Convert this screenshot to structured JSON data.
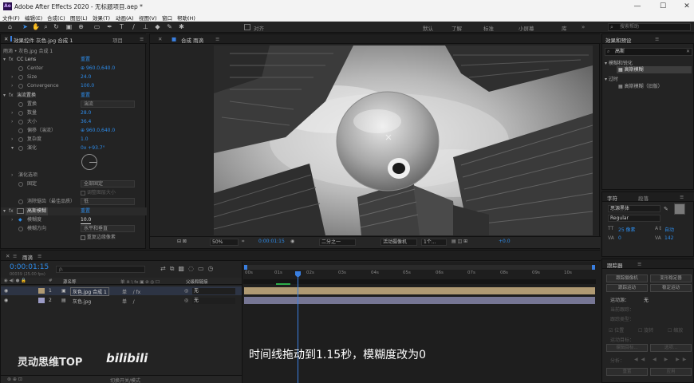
{
  "window": {
    "logo": "Ae",
    "title": "Adobe After Effects 2020 - 无标题项目.aep *",
    "controls": [
      "—",
      "☐",
      "✕"
    ]
  },
  "menu": [
    "文件(F)",
    "编辑(E)",
    "合成(C)",
    "图层(L)",
    "效果(T)",
    "动画(A)",
    "视图(V)",
    "窗口",
    "帮助(H)"
  ],
  "toolbar": {
    "align_label": "对齐",
    "workspaces": [
      "默认",
      "了解",
      "标准",
      "小屏幕",
      "库"
    ],
    "search_placeholder": "搜索帮助"
  },
  "effect_controls": {
    "tab_label": "效果控件 灰色.jpg 合成 1",
    "tab2_label": "项目",
    "breadcrumb": "雨滴 • 灰色.jpg 合成 1",
    "cc_lens": {
      "name": "CC Lens",
      "reset": "重置",
      "center_label": "Center",
      "center_value": "960.0,640.0",
      "size_label": "Size",
      "size_value": "24.0",
      "convergence_label": "Convergence",
      "convergence_value": "100.0"
    },
    "wave_warp": {
      "name": "湍流置换",
      "reset": "重置",
      "displace_label": "置换",
      "displace_value": "湍流",
      "amount_label": "数量",
      "amount_value": "28.0",
      "size_label": "大小",
      "size_value": "36.4",
      "offset_label": "偏移（湍流）",
      "offset_value": "960.0,640.0",
      "complexity_label": "复杂度",
      "complexity_value": "1.0",
      "evolution_label": "演化",
      "evolution_value": "0x +93.7°",
      "evolution_options_label": "演化选项",
      "pinning_label": "固定",
      "pinning_value": "全部固定",
      "resize_label": "调整图层大小",
      "antialias_label": "消除锯齿（最佳品质）",
      "antialias_value": "低"
    },
    "gaussian_blur": {
      "name": "高斯模糊",
      "reset": "重置",
      "blurriness_label": "模糊度",
      "blurriness_value": "10.0",
      "direction_label": "模糊方向",
      "direction_value": "水平和垂直",
      "repeat_label": "重复边缘像素"
    }
  },
  "composition": {
    "tab_label": "合成 雨滴",
    "footer_zoom": "50%",
    "footer_time": "0:00:01:15",
    "footer_resolution": "二分之一",
    "footer_camera": "活动摄像机",
    "footer_views": "1个...",
    "footer_exposure": "+0.0"
  },
  "timeline": {
    "tab_label": "雨滴",
    "current_time": "0:00:01:15",
    "frame_info": "00039 (25.00 fps)",
    "search_placeholder": "ρ.",
    "col_source": "源名称",
    "col_parent": "父级和链接",
    "layers": [
      {
        "num": "1",
        "name": "灰色.jpg 合成 1",
        "parent": "无",
        "color": "#b09a73"
      },
      {
        "num": "2",
        "name": "灰色.jpg",
        "parent": "无",
        "color": "#9b9bc6"
      }
    ],
    "ruler": [
      "00s",
      "01s",
      "02s",
      "03s",
      "04s",
      "05s",
      "06s",
      "07s",
      "08s",
      "09s",
      "10s"
    ],
    "footer": "切换开关/模式"
  },
  "effects_presets": {
    "tab_label": "效果和预设",
    "search_value": "高斯",
    "category1": "模糊和锐化",
    "item1": "高斯模糊",
    "category2": "过时",
    "item2": "高斯模糊（旧版）"
  },
  "character": {
    "tab_label": "字符",
    "tab2_label": "段落",
    "font": "思源黑体",
    "style": "Regular",
    "size": "25 像素",
    "leading": "自动",
    "tracking": "0",
    "kerning": "142"
  },
  "tracker": {
    "tab_label": "跟踪器",
    "btn_track_camera": "跟踪摄像机",
    "btn_warp": "变形稳定器",
    "btn_track_motion": "跟踪运动",
    "btn_stabilize": "稳定运动",
    "source_label": "运动源：",
    "source_value": "无",
    "current_track_label": "当前跟踪：",
    "track_type_label": "跟踪类型：",
    "position_label": "位置",
    "rotation_label": "旋转",
    "scale_label": "缩放",
    "motion_target_label": "运动目标：",
    "edit_target": "编辑目标...",
    "options": "选项...",
    "analyze_label": "分析：",
    "reset": "重置",
    "apply": "应用"
  },
  "overlay": {
    "watermark_text": "灵动思维TOP",
    "watermark_logo": "bilibili",
    "subtitle": "时间线拖动到1.15秒，模糊度改为0"
  },
  "colors": {
    "accent_blue": "#2d8ceb",
    "playhead": "#3a7fe0",
    "layer1": "#b09a73",
    "layer2": "#9b9bc6",
    "brand_purple": "#2a0f4f"
  }
}
